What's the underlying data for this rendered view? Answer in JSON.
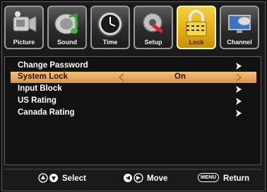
{
  "tabs": [
    {
      "label": "Picture",
      "icon": "camcorder-icon",
      "active": false
    },
    {
      "label": "Sound",
      "icon": "music-note-icon",
      "active": false
    },
    {
      "label": "Time",
      "icon": "clock-icon",
      "active": false
    },
    {
      "label": "Setup",
      "icon": "tools-icon",
      "active": false
    },
    {
      "label": "Lock",
      "icon": "padlock-icon",
      "active": true
    },
    {
      "label": "Channel",
      "icon": "satellite-dish-icon",
      "active": false
    }
  ],
  "menu": {
    "items": [
      {
        "label": "Change Password",
        "value": "",
        "selected": false
      },
      {
        "label": "System Lock",
        "value": "On",
        "selected": true
      },
      {
        "label": "Input Block",
        "value": "",
        "selected": false
      },
      {
        "label": "US Rating",
        "value": "",
        "selected": false
      },
      {
        "label": "Canada Rating",
        "value": "",
        "selected": false
      }
    ]
  },
  "footer": {
    "select_label": "Select",
    "move_label": "Move",
    "menu_key": "MENU",
    "return_label": "Return"
  },
  "colors": {
    "accent": "#e5ae18",
    "selection": "#e8a960"
  }
}
